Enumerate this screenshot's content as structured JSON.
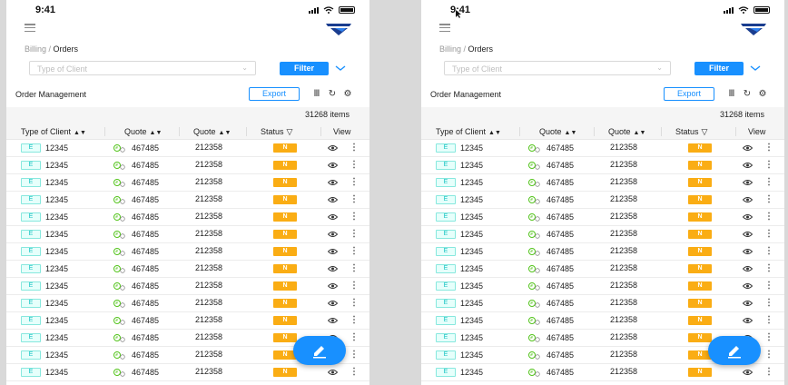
{
  "screens": [
    {
      "status_time": "9:41",
      "breadcrumb": {
        "parent": "Billing",
        "separator": " / ",
        "current": "Orders"
      },
      "filter": {
        "placeholder": "Type of Client",
        "button_label": "Filter"
      },
      "toolbar": {
        "title": "Order Management",
        "export_label": "Export"
      },
      "items_count": "31268 items",
      "columns": [
        "Type of Client",
        "Quote",
        "Quote",
        "Status",
        "View"
      ],
      "rows": [
        {
          "tag": "E",
          "client_id": "12345",
          "quote1": "467485",
          "quote2": "212358",
          "status": "N"
        },
        {
          "tag": "E",
          "client_id": "12345",
          "quote1": "467485",
          "quote2": "212358",
          "status": "N"
        },
        {
          "tag": "E",
          "client_id": "12345",
          "quote1": "467485",
          "quote2": "212358",
          "status": "N"
        },
        {
          "tag": "E",
          "client_id": "12345",
          "quote1": "467485",
          "quote2": "212358",
          "status": "N"
        },
        {
          "tag": "E",
          "client_id": "12345",
          "quote1": "467485",
          "quote2": "212358",
          "status": "N"
        },
        {
          "tag": "E",
          "client_id": "12345",
          "quote1": "467485",
          "quote2": "212358",
          "status": "N"
        },
        {
          "tag": "E",
          "client_id": "12345",
          "quote1": "467485",
          "quote2": "212358",
          "status": "N"
        },
        {
          "tag": "E",
          "client_id": "12345",
          "quote1": "467485",
          "quote2": "212358",
          "status": "N"
        },
        {
          "tag": "E",
          "client_id": "12345",
          "quote1": "467485",
          "quote2": "212358",
          "status": "N"
        },
        {
          "tag": "E",
          "client_id": "12345",
          "quote1": "467485",
          "quote2": "212358",
          "status": "N"
        },
        {
          "tag": "E",
          "client_id": "12345",
          "quote1": "467485",
          "quote2": "212358",
          "status": "N"
        },
        {
          "tag": "E",
          "client_id": "12345",
          "quote1": "467485",
          "quote2": "212358",
          "status": "N"
        },
        {
          "tag": "E",
          "client_id": "12345",
          "quote1": "467485",
          "quote2": "212358",
          "status": "N"
        },
        {
          "tag": "E",
          "client_id": "12345",
          "quote1": "467485",
          "quote2": "212358",
          "status": "N"
        }
      ]
    },
    {
      "status_time": "9:41",
      "breadcrumb": {
        "parent": "Billing",
        "separator": " / ",
        "current": "Orders"
      },
      "filter": {
        "placeholder": "Type of Client",
        "button_label": "Filter"
      },
      "toolbar": {
        "title": "Order Management",
        "export_label": "Export"
      },
      "items_count": "31268 items",
      "columns": [
        "Type of Client",
        "Quote",
        "Quote",
        "Status",
        "View"
      ],
      "rows": [
        {
          "tag": "E",
          "client_id": "12345",
          "quote1": "467485",
          "quote2": "212358",
          "status": "N"
        },
        {
          "tag": "E",
          "client_id": "12345",
          "quote1": "467485",
          "quote2": "212358",
          "status": "N"
        },
        {
          "tag": "E",
          "client_id": "12345",
          "quote1": "467485",
          "quote2": "212358",
          "status": "N"
        },
        {
          "tag": "E",
          "client_id": "12345",
          "quote1": "467485",
          "quote2": "212358",
          "status": "N"
        },
        {
          "tag": "E",
          "client_id": "12345",
          "quote1": "467485",
          "quote2": "212358",
          "status": "N"
        },
        {
          "tag": "E",
          "client_id": "12345",
          "quote1": "467485",
          "quote2": "212358",
          "status": "N"
        },
        {
          "tag": "E",
          "client_id": "12345",
          "quote1": "467485",
          "quote2": "212358",
          "status": "N"
        },
        {
          "tag": "E",
          "client_id": "12345",
          "quote1": "467485",
          "quote2": "212358",
          "status": "N"
        },
        {
          "tag": "E",
          "client_id": "12345",
          "quote1": "467485",
          "quote2": "212358",
          "status": "N"
        },
        {
          "tag": "E",
          "client_id": "12345",
          "quote1": "467485",
          "quote2": "212358",
          "status": "N"
        },
        {
          "tag": "E",
          "client_id": "12345",
          "quote1": "467485",
          "quote2": "212358",
          "status": "N"
        },
        {
          "tag": "E",
          "client_id": "12345",
          "quote1": "467485",
          "quote2": "212358",
          "status": "N"
        },
        {
          "tag": "E",
          "client_id": "12345",
          "quote1": "467485",
          "quote2": "212358",
          "status": "N"
        },
        {
          "tag": "E",
          "client_id": "12345",
          "quote1": "467485",
          "quote2": "212358",
          "status": "N"
        }
      ]
    }
  ],
  "colors": {
    "primary": "#1890ff",
    "status_warning": "#faad14",
    "tag_cyan": "#13c2c2",
    "quote_icon": "#52c41a"
  },
  "icons": [
    "menu-icon",
    "logo-icon",
    "chevron-down-icon",
    "text-height-icon",
    "reload-icon",
    "settings-icon",
    "sort-icon",
    "filter-icon",
    "quote-icon",
    "eye-icon",
    "more-icon",
    "edit-icon"
  ]
}
